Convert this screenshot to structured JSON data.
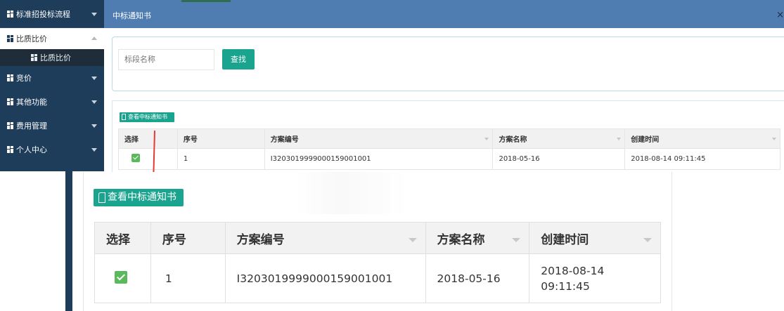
{
  "sidebar": {
    "items": [
      {
        "label": "标准招投标流程"
      },
      {
        "label": "比质比价"
      },
      {
        "label": "比质比价"
      },
      {
        "label": "竞价"
      },
      {
        "label": "其他功能"
      },
      {
        "label": "费用管理"
      },
      {
        "label": "个人中心"
      }
    ]
  },
  "modal": {
    "title": "中标通知书",
    "close": "×"
  },
  "search": {
    "placeholder": "标段名称",
    "button_label": "查找"
  },
  "toolbar": {
    "view_label": "查看中标通知书"
  },
  "table": {
    "headers": [
      "选择",
      "序号",
      "方案编号",
      "方案名称",
      "创建时间"
    ],
    "rows": [
      {
        "selected": true,
        "index": "1",
        "plan_code": "I3203019999000159001001",
        "plan_name": "2018-05-16",
        "created_time": "2018-08-14 09:11:45",
        "created_date": "2018-08-14",
        "created_clock": "09:11:45"
      }
    ]
  },
  "colors": {
    "sidebar_bg": "#1e3d5b",
    "header_bg": "#4f7db1",
    "accent_green": "#1aa48f",
    "check_green": "#5cb85c",
    "annotation_red": "#e53935"
  }
}
